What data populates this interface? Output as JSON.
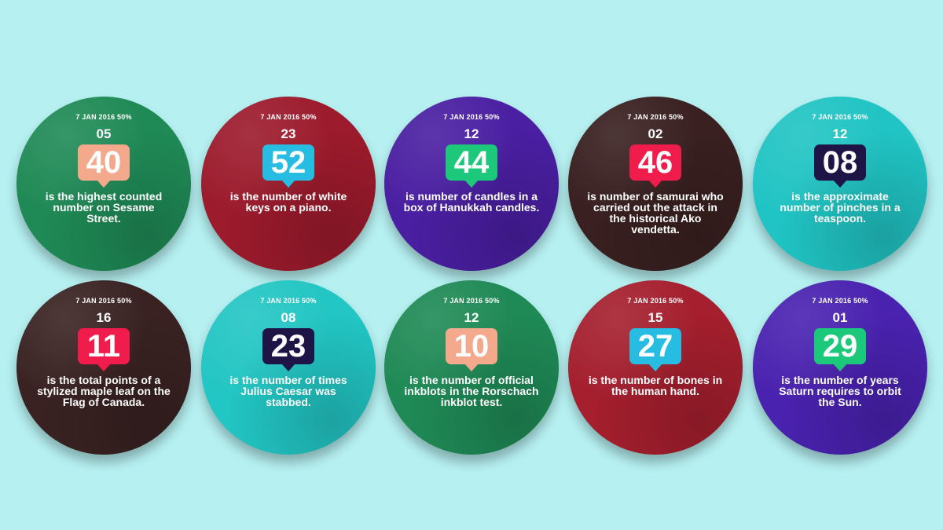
{
  "faces": [
    {
      "date": "7 JAN 2016 50%",
      "small": "05",
      "big": "40",
      "caption": "is the highest counted number on Sesame Street.",
      "bg": "#1f8a56",
      "badge": "#f4a98c"
    },
    {
      "date": "7 JAN 2016 50%",
      "small": "23",
      "big": "52",
      "caption": "is the number of white keys on a piano.",
      "bg": "#9c1b2c",
      "badge": "#27bde2"
    },
    {
      "date": "7 JAN 2016 50%",
      "small": "12",
      "big": "44",
      "caption": "is number of candles in a box of Hanukkah candles.",
      "bg": "#4a1fa2",
      "badge": "#1cc97a"
    },
    {
      "date": "7 JAN 2016 50%",
      "small": "02",
      "big": "46",
      "caption": "is number of samurai who carried out the attack in the historical Ako vendetta.",
      "bg": "#3a2020",
      "badge": "#ef1c4c"
    },
    {
      "date": "7 JAN 2016 50%",
      "small": "12",
      "big": "08",
      "caption": "is the approximate number of pinches in a teaspoon.",
      "bg": "#21c4c4",
      "badge": "#1e1446"
    },
    {
      "date": "7 JAN 2016 50%",
      "small": "16",
      "big": "11",
      "caption": "is the total points of a stylized maple leaf on the Flag of Canada.",
      "bg": "#3a2222",
      "badge": "#ef1c4c"
    },
    {
      "date": "7 JAN 2016 50%",
      "small": "08",
      "big": "23",
      "caption": "is the number of times Julius Caesar was stabbed.",
      "bg": "#22c6c4",
      "badge": "#1e1446"
    },
    {
      "date": "7 JAN 2016 50%",
      "small": "12",
      "big": "10",
      "caption": "is the number of official inkblots in the Rorschach inkblot test.",
      "bg": "#1f8a56",
      "badge": "#f4a98c"
    },
    {
      "date": "7 JAN 2016 50%",
      "small": "15",
      "big": "27",
      "caption": "is the number of bones in the human hand.",
      "bg": "#a51f2e",
      "badge": "#27bde2"
    },
    {
      "date": "7 JAN 2016 50%",
      "small": "01",
      "big": "29",
      "caption": "is the number of years Saturn requires to orbit the Sun.",
      "bg": "#4a22b0",
      "badge": "#1cc97a"
    }
  ]
}
